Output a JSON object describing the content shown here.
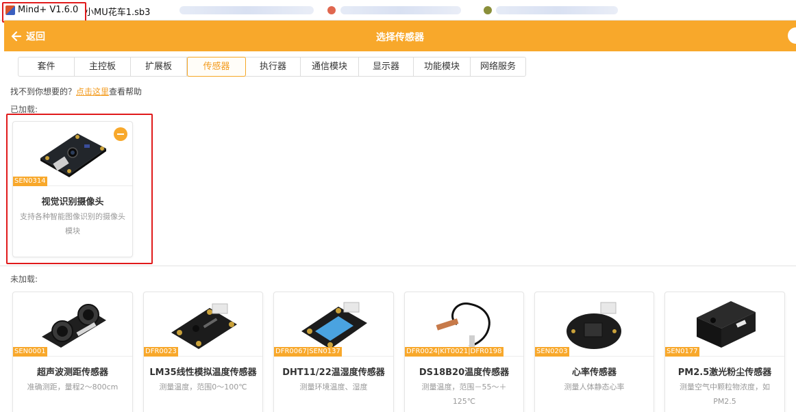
{
  "window": {
    "app_title": "Mind+ V1.6.0",
    "file_name": "小MU花车1.sb3"
  },
  "header": {
    "back_label": "返回",
    "title": "选择传感器"
  },
  "tabs": [
    {
      "label": "套件",
      "active": false
    },
    {
      "label": "主控板",
      "active": false
    },
    {
      "label": "扩展板",
      "active": false
    },
    {
      "label": "传感器",
      "active": true
    },
    {
      "label": "执行器",
      "active": false
    },
    {
      "label": "通信模块",
      "active": false
    },
    {
      "label": "显示器",
      "active": false
    },
    {
      "label": "功能模块",
      "active": false
    },
    {
      "label": "网络服务",
      "active": false
    }
  ],
  "help": {
    "prefix": "找不到你想要的？",
    "link": "点击这里",
    "suffix": "查看帮助"
  },
  "loaded": {
    "label": "已加载:",
    "cards": [
      {
        "code": "SEN0314",
        "name": "视觉识别摄像头",
        "desc": "支持各种智能图像识别的摄像头模块",
        "image": "camera-module"
      }
    ]
  },
  "unloaded": {
    "label": "未加载:",
    "cards": [
      {
        "code": "SEN0001",
        "name": "超声波测距传感器",
        "desc": "准确测距，量程2～800cm",
        "image": "ultrasonic"
      },
      {
        "code": "DFR0023",
        "name": "LM35线性模拟温度传感器",
        "desc": "测量温度，范围0～100℃",
        "image": "lm35"
      },
      {
        "code": "DFR0067|SEN0137",
        "name": "DHT11/22温湿度传感器",
        "desc": "测量环境温度、湿度",
        "image": "dht11"
      },
      {
        "code": "DFR0024|KIT0021|DFR0198",
        "name": "DS18B20温度传感器",
        "desc": "测量温度，范围－55～＋125℃",
        "image": "ds18b20"
      },
      {
        "code": "SEN0203",
        "name": "心率传感器",
        "desc": "测量人体静态心率",
        "image": "heart-rate"
      },
      {
        "code": "SEN0177",
        "name": "PM2.5激光粉尘传感器",
        "desc": "测量空气中颗粒物浓度，如PM2.5",
        "image": "pm25"
      }
    ]
  },
  "colors": {
    "accent": "#f8a82b",
    "active_tab": "#f39a1c",
    "highlight": "#e0191a"
  }
}
